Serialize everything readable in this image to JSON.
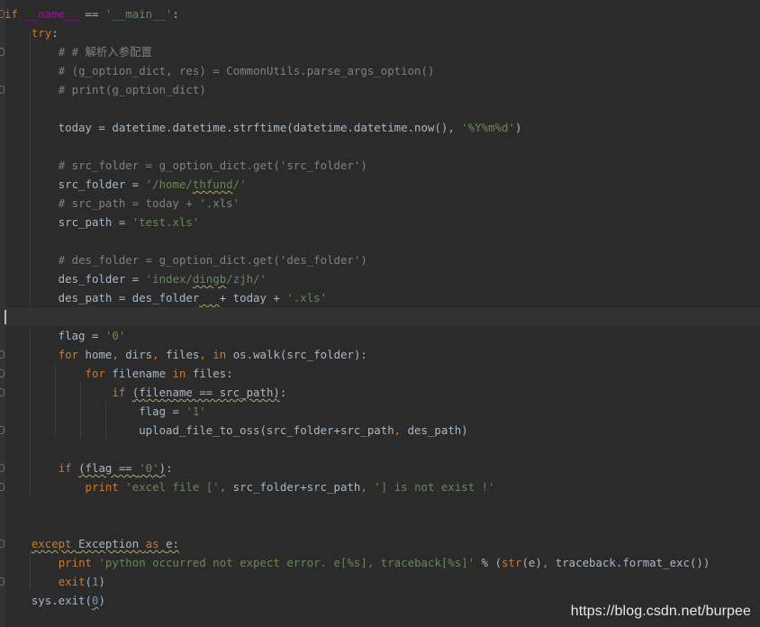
{
  "editor": {
    "lines": [
      [
        [
          "kw",
          "if "
        ],
        [
          "dunder",
          "__name__"
        ],
        [
          "plain",
          " == "
        ],
        [
          "str",
          "'__main__'"
        ],
        [
          "plain",
          ":"
        ]
      ],
      [
        [
          "plain",
          "    "
        ],
        [
          "kw",
          "try"
        ],
        [
          "plain",
          ":"
        ]
      ],
      [
        [
          "plain",
          "        "
        ],
        [
          "cm",
          "# # 解析入参配置"
        ]
      ],
      [
        [
          "plain",
          "        "
        ],
        [
          "cm",
          "# (g_option_dict, res) = CommonUtils.parse_args_option()"
        ]
      ],
      [
        [
          "plain",
          "        "
        ],
        [
          "cm",
          "# print(g_option_dict)"
        ]
      ],
      [],
      [
        [
          "plain",
          "        today = datetime.datetime.strftime(datetime.datetime.now(), "
        ],
        [
          "str",
          "'%Y%m%d'"
        ],
        [
          "plain",
          ")"
        ]
      ],
      [],
      [
        [
          "plain",
          "        "
        ],
        [
          "cm",
          "# src_folder = g_option_dict.get('src_folder')"
        ]
      ],
      [
        [
          "plain",
          "        src_folder = "
        ],
        [
          "str",
          "'/home/"
        ],
        [
          "str sq",
          "thfund"
        ],
        [
          "str",
          "/'"
        ]
      ],
      [
        [
          "plain",
          "        "
        ],
        [
          "cm",
          "# src_path = today + '.xls'"
        ]
      ],
      [
        [
          "plain",
          "        src_path = "
        ],
        [
          "str",
          "'test.xls'"
        ]
      ],
      [],
      [
        [
          "plain",
          "        "
        ],
        [
          "cm",
          "# des_folder = g_option_dict.get('des_folder')"
        ]
      ],
      [
        [
          "plain",
          "        des_folder = "
        ],
        [
          "str",
          "'index/"
        ],
        [
          "str sq",
          "dingb"
        ],
        [
          "str",
          "/zjh/'"
        ]
      ],
      [
        [
          "plain",
          "        des_path = des_folder"
        ],
        [
          "plain sq",
          "   "
        ],
        [
          "plain",
          "+ today + "
        ],
        [
          "str",
          "'.xls'"
        ]
      ],
      [],
      [
        [
          "plain",
          "        flag = "
        ],
        [
          "str",
          "'0'"
        ]
      ],
      [
        [
          "plain",
          "        "
        ],
        [
          "kw",
          "for "
        ],
        [
          "plain",
          "home"
        ],
        [
          "kw",
          ", "
        ],
        [
          "plain",
          "dirs"
        ],
        [
          "kw",
          ", "
        ],
        [
          "plain",
          "files"
        ],
        [
          "kw",
          ", in "
        ],
        [
          "plain",
          "os.walk(src_folder):"
        ]
      ],
      [
        [
          "plain",
          "            "
        ],
        [
          "kw",
          "for "
        ],
        [
          "plain",
          "filename "
        ],
        [
          "kw",
          "in "
        ],
        [
          "plain",
          "files:"
        ]
      ],
      [
        [
          "plain",
          "                "
        ],
        [
          "kw",
          "if "
        ],
        [
          "plain sq",
          "(filename == src_path)"
        ],
        [
          "plain",
          ":"
        ]
      ],
      [
        [
          "plain",
          "                    flag = "
        ],
        [
          "str",
          "'1'"
        ]
      ],
      [
        [
          "plain",
          "                    upload_file_to_oss(src_folder+src_path"
        ],
        [
          "kw",
          ", "
        ],
        [
          "plain",
          "des_path)"
        ]
      ],
      [],
      [
        [
          "plain",
          "        "
        ],
        [
          "kw",
          "if "
        ],
        [
          "plain sq",
          "(flag == "
        ],
        [
          "str sq",
          "'0'"
        ],
        [
          "plain sq",
          ")"
        ],
        [
          "plain",
          ":"
        ]
      ],
      [
        [
          "plain",
          "            "
        ],
        [
          "kw",
          "print "
        ],
        [
          "str",
          "'excel file ['"
        ],
        [
          "kw",
          ", "
        ],
        [
          "plain",
          "src_folder+src_path"
        ],
        [
          "kw",
          ", "
        ],
        [
          "str",
          "'] is not exist !'"
        ]
      ],
      [],
      [],
      [
        [
          "plain",
          "    "
        ],
        [
          "kw sq",
          "except "
        ],
        [
          "plain sq",
          "Exception "
        ],
        [
          "kw sq",
          "as "
        ],
        [
          "plain sq",
          "e:"
        ]
      ],
      [
        [
          "plain",
          "        "
        ],
        [
          "kw",
          "print "
        ],
        [
          "str",
          "'python occurred not expect error. e[%s], traceback[%s]'"
        ],
        [
          "plain",
          " % ("
        ],
        [
          "kw",
          "str"
        ],
        [
          "plain",
          "(e)"
        ],
        [
          "kw",
          ", "
        ],
        [
          "plain",
          "traceback.format_exc())"
        ]
      ],
      [
        [
          "plain",
          "        "
        ],
        [
          "kw",
          "exit"
        ],
        [
          "plain",
          "("
        ],
        [
          "num",
          "1"
        ],
        [
          "plain",
          ")"
        ]
      ],
      [
        [
          "plain",
          "    sys.exit("
        ],
        [
          "num sq",
          "0"
        ],
        [
          "plain",
          ")"
        ]
      ]
    ]
  },
  "watermark": {
    "text": "https://blog.csdn.net/burpee"
  },
  "colors": {
    "background": "#2b2b2b",
    "current_line": "#323232",
    "keyword": "#cc7832",
    "string": "#6a8759",
    "comment": "#808080",
    "number": "#6897bb",
    "dunder": "#b200b2",
    "text": "#a9b7c6"
  }
}
